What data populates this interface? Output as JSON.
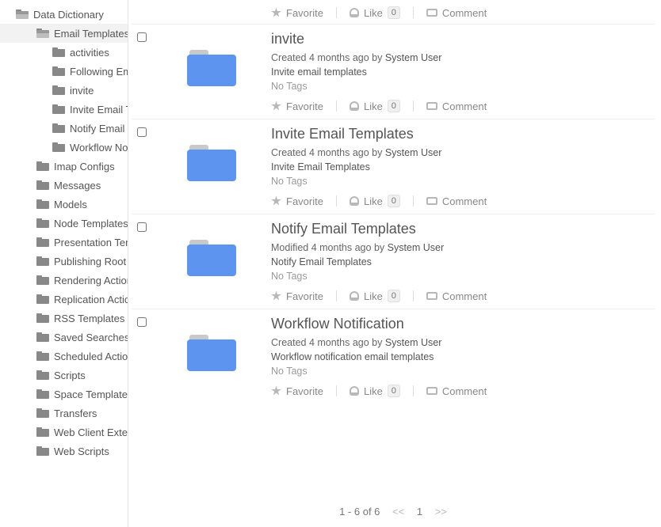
{
  "sidebar": {
    "root": "Data Dictionary",
    "email_templates": "Email Templates",
    "children": [
      "activities",
      "Following Email Templates",
      "invite",
      "Invite Email Templates",
      "Notify Email Templates",
      "Workflow Notification"
    ],
    "siblings": [
      "Imap Configs",
      "Messages",
      "Models",
      "Node Templates",
      "Presentation Templates",
      "Publishing Root",
      "Rendering Actions",
      "Replication Actions",
      "RSS Templates",
      "Saved Searches",
      "Scheduled Actions",
      "Scripts",
      "Space Templates",
      "Transfers",
      "Web Client Extension",
      "Web Scripts"
    ]
  },
  "action_labels": {
    "favorite": "Favorite",
    "like": "Like",
    "comment": "Comment",
    "like_count": "0"
  },
  "no_tags": "No Tags",
  "items": [
    {
      "title": "invite",
      "meta_prefix": "Created 4 months ago by ",
      "user": "System User",
      "desc": "Invite email templates"
    },
    {
      "title": "Invite Email Templates",
      "meta_prefix": "Created 4 months ago by ",
      "user": "System User",
      "desc": "Invite Email Templates"
    },
    {
      "title": "Notify Email Templates",
      "meta_prefix": "Modified 4 months ago by ",
      "user": "System User",
      "desc": "Notify Email Templates"
    },
    {
      "title": "Workflow Notification",
      "meta_prefix": "Created 4 months ago by ",
      "user": "System User",
      "desc": "Workflow notification email templates"
    }
  ],
  "pagination": {
    "range": "1 - 6 of 6",
    "prev": "<<",
    "page": "1",
    "next": ">>"
  }
}
